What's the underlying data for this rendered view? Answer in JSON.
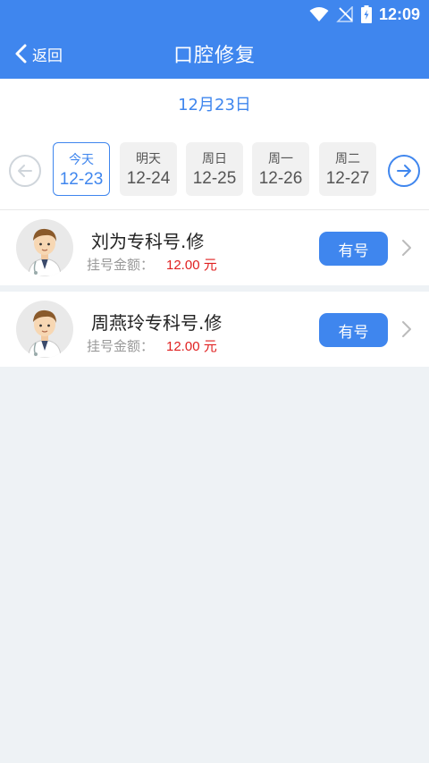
{
  "status_bar": {
    "time": "12:09"
  },
  "nav": {
    "back_label": "返回",
    "title": "口腔修复"
  },
  "calendar": {
    "current_date": "12月23日",
    "days": [
      {
        "weekday": "今天",
        "date": "12-23",
        "active": true
      },
      {
        "weekday": "明天",
        "date": "12-24",
        "active": false
      },
      {
        "weekday": "周日",
        "date": "12-25",
        "active": false
      },
      {
        "weekday": "周一",
        "date": "12-26",
        "active": false
      },
      {
        "weekday": "周二",
        "date": "12-27",
        "active": false
      }
    ]
  },
  "doctors": [
    {
      "name": "刘为专科号.修",
      "fee_label": "挂号金额：",
      "fee": "12.00 元",
      "status": "有号"
    },
    {
      "name": "周燕玲专科号.修",
      "fee_label": "挂号金额：",
      "fee": "12.00 元",
      "status": "有号"
    }
  ],
  "colors": {
    "primary": "#3f86ee",
    "fee": "#e02020",
    "background": "#eef2f5"
  }
}
